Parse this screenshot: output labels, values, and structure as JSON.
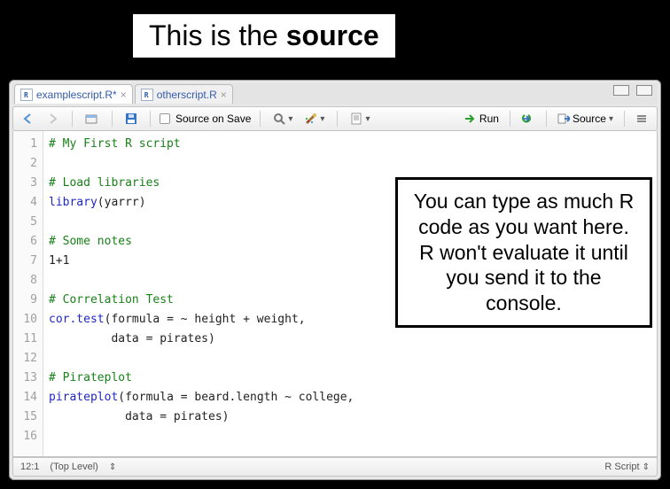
{
  "hero": {
    "prefix": "This is the ",
    "bold": "source"
  },
  "tabs": [
    {
      "file": "examplescript.R*",
      "active": true
    },
    {
      "file": "otherscript.R",
      "active": false
    }
  ],
  "toolbar": {
    "source_on_save": "Source on Save",
    "run": "Run",
    "source": "Source"
  },
  "code": {
    "lines": [
      {
        "n": 1,
        "type": "comment",
        "text": "# My First R script"
      },
      {
        "n": 2,
        "type": "blank",
        "text": ""
      },
      {
        "n": 3,
        "type": "comment",
        "text": "# Load libraries"
      },
      {
        "n": 4,
        "type": "call",
        "func": "library",
        "args": "(yarrr)"
      },
      {
        "n": 5,
        "type": "blank",
        "text": ""
      },
      {
        "n": 6,
        "type": "comment",
        "text": "# Some notes"
      },
      {
        "n": 7,
        "type": "plain",
        "text": "1+1"
      },
      {
        "n": 8,
        "type": "blank",
        "text": ""
      },
      {
        "n": 9,
        "type": "comment",
        "text": "# Correlation Test"
      },
      {
        "n": 10,
        "type": "call",
        "func": "cor.test",
        "args": "(formula = ~ height + weight,"
      },
      {
        "n": 11,
        "type": "plain",
        "text": "         data = pirates)"
      },
      {
        "n": 12,
        "type": "blank",
        "text": ""
      },
      {
        "n": 13,
        "type": "comment",
        "text": "# Pirateplot"
      },
      {
        "n": 14,
        "type": "call",
        "func": "pirateplot",
        "args": "(formula = beard.length ~ college,"
      },
      {
        "n": 15,
        "type": "plain",
        "text": "           data = pirates)"
      },
      {
        "n": 16,
        "type": "blank",
        "text": ""
      }
    ]
  },
  "status": {
    "cursor": "12:1",
    "scope": "(Top Level)",
    "type": "R Script"
  },
  "callout": "You can type as much R code as you want here. R won't evaluate it until you send it to the console."
}
